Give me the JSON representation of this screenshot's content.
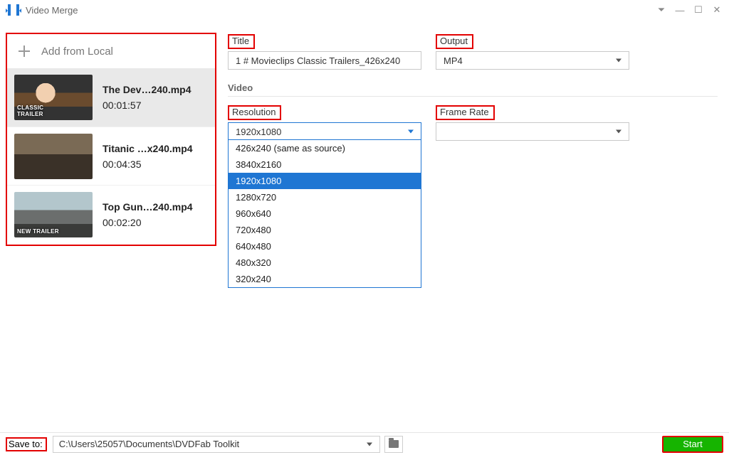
{
  "app": {
    "title": "Video Merge"
  },
  "window_controls": {
    "pin": "⏷",
    "min": "—",
    "max": "☐",
    "close": "✕"
  },
  "sidebar": {
    "add_label": "Add from Local",
    "items": [
      {
        "name": "The Dev…240.mp4",
        "duration": "00:01:57",
        "tag": "CLASSIC\nTRAILER",
        "selected": true,
        "thumb": "devil"
      },
      {
        "name": "Titanic …x240.mp4",
        "duration": "00:04:35",
        "tag": "",
        "selected": false,
        "thumb": "titanic"
      },
      {
        "name": "Top Gun…240.mp4",
        "duration": "00:02:20",
        "tag": "NEW TRAILER",
        "selected": false,
        "thumb": "topgun"
      }
    ]
  },
  "form": {
    "title_label": "Title",
    "title_value": "1 # Movieclips Classic Trailers_426x240",
    "output_label": "Output",
    "output_value": "MP4",
    "video_header": "Video",
    "resolution_label": "Resolution",
    "resolution_value": "1920x1080",
    "resolution_options": [
      "426x240 (same as source)",
      "3840x2160",
      "1920x1080",
      "1280x720",
      "960x640",
      "720x480",
      "640x480",
      "480x320",
      "320x240"
    ],
    "resolution_selected_index": 2,
    "framerate_label": "Frame Rate",
    "framerate_value": ""
  },
  "footer": {
    "save_label": "Save to:",
    "save_path": "C:\\Users\\25057\\Documents\\DVDFab Toolkit",
    "start_label": "Start"
  }
}
